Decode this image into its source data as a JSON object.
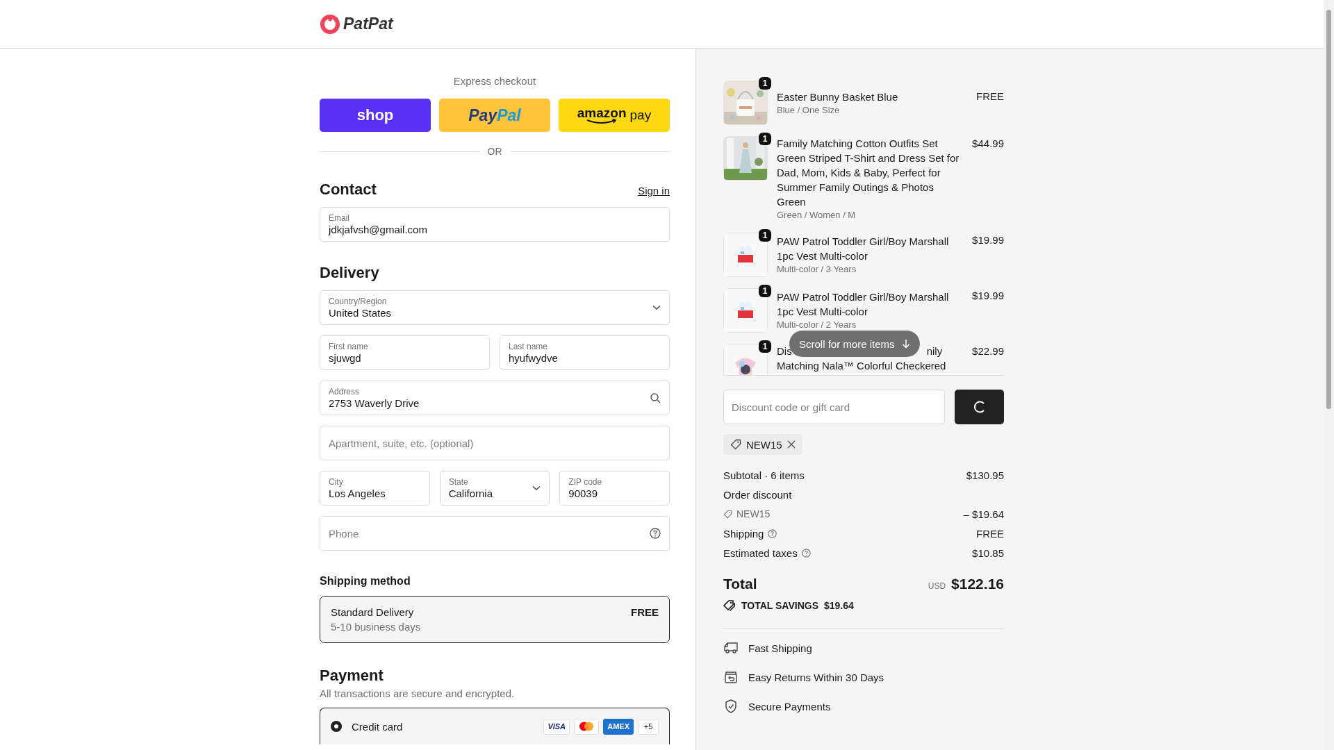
{
  "header": {
    "logo": "PatPat"
  },
  "express_checkout": {
    "title": "Express checkout",
    "separator": "OR",
    "buttons": [
      {
        "kind": "shop",
        "parts": [
          "shop"
        ]
      },
      {
        "kind": "paypal",
        "parts": [
          "Pay",
          "Pal"
        ]
      },
      {
        "kind": "amazon",
        "parts": [
          "amazon",
          "pay"
        ]
      }
    ]
  },
  "contact": {
    "title": "Contact",
    "sign_in": "Sign in",
    "email": {
      "label": "Email",
      "value": "jdkjafvsh@gmail.com"
    }
  },
  "delivery": {
    "title": "Delivery",
    "rows": [
      [
        {
          "kind": "select",
          "label": "Country/Region",
          "value": "United States"
        }
      ],
      [
        {
          "kind": "text",
          "label": "First name",
          "value": "sjuwgd"
        },
        {
          "kind": "text",
          "label": "Last name",
          "value": "hyufwydve"
        }
      ],
      [
        {
          "kind": "search",
          "label": "Address",
          "value": "2753 Waverly Drive"
        }
      ],
      [
        {
          "kind": "text",
          "placeholder": "Apartment, suite, etc. (optional)"
        }
      ],
      [
        {
          "kind": "text",
          "label": "City",
          "value": "Los Angeles"
        },
        {
          "kind": "select",
          "label": "State",
          "value": "California"
        },
        {
          "kind": "text",
          "label": "ZIP code",
          "value": "90039"
        }
      ],
      [
        {
          "kind": "help",
          "placeholder": "Phone"
        }
      ]
    ]
  },
  "shipping_method": {
    "title": "Shipping method",
    "options": [
      {
        "name": "Standard Delivery",
        "detail": "5-10 business days",
        "price": "FREE",
        "selected": true
      }
    ]
  },
  "payment": {
    "title": "Payment",
    "subtitle": "All transactions are secure and encrypted.",
    "methods": [
      {
        "label": "Credit card",
        "selected": true,
        "cards": [
          {
            "kind": "visa",
            "label": "VISA"
          },
          {
            "kind": "mastercard"
          },
          {
            "kind": "amex",
            "label": "AMEX"
          },
          {
            "kind": "more",
            "label": "+5"
          }
        ]
      }
    ]
  },
  "order": {
    "scroll_hint": "Scroll for more items",
    "items": [
      {
        "kind": "basket",
        "quantity": "1",
        "title": "Easter Bunny Basket Blue",
        "variant": "Blue / One Size",
        "price": "FREE"
      },
      {
        "kind": "dress",
        "quantity": "1",
        "title": "Family Matching Cotton Outfits Set Green Striped T-Shirt and Dress Set for Dad, Mom, Kids & Baby, Perfect for Summer Family Outings & Photos Green",
        "variant": "Green / Women / M",
        "price": "$44.99"
      },
      {
        "kind": "vest",
        "quantity": "1",
        "title": "PAW Patrol Toddler Girl/Boy Marshall 1pc Vest Multi-color",
        "variant": "Multi-color / 3 Years",
        "price": "$19.99"
      },
      {
        "kind": "vest",
        "quantity": "1",
        "title": "PAW Patrol Toddler Girl/Boy Marshall 1pc Vest Multi-color",
        "variant": "Multi-color / 2 Years",
        "price": "$19.99"
      },
      {
        "kind": "shirt",
        "quantity": "1",
        "title_parts": [
          "Dis",
          "nily"
        ],
        "title_line_2": "Matching Nala™ Colorful Checkered",
        "price": "$22.99"
      }
    ]
  },
  "discount": {
    "placeholder": "Discount code or gift card",
    "applied": [
      "NEW15"
    ]
  },
  "summary": [
    {
      "kind": "plain",
      "label": "Subtotal · 6 items",
      "value": "$130.95"
    },
    {
      "kind": "discount",
      "label": "Order discount",
      "code": "NEW15",
      "value": "– $19.64"
    },
    {
      "kind": "help",
      "label": "Shipping",
      "value": "FREE"
    },
    {
      "kind": "help",
      "label": "Estimated taxes",
      "value": "$10.85"
    }
  ],
  "total": {
    "label": "Total",
    "currency": "USD",
    "amount": "$122.16",
    "savings_label": "TOTAL SAVINGS",
    "savings": "$19.64"
  },
  "features": [
    {
      "kind": "truck",
      "label": "Fast Shipping"
    },
    {
      "kind": "returns",
      "label": "Easy Returns Within 30 Days"
    },
    {
      "kind": "shield",
      "label": "Secure Payments"
    }
  ]
}
